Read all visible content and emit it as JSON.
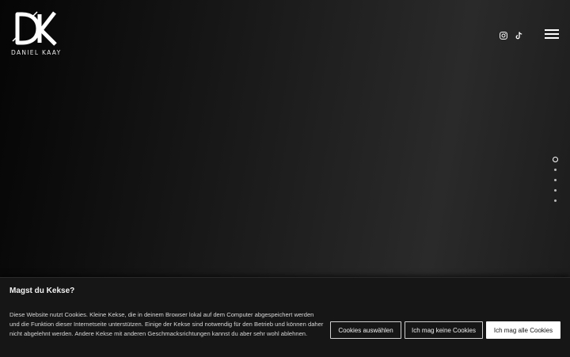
{
  "header": {
    "logo_mark": "DK",
    "logo_text": "DANIEL KAAY",
    "social_icons": [
      "instagram-icon",
      "tiktok-icon"
    ],
    "menu_icon": "hamburger-menu-icon"
  },
  "section_nav": {
    "count": 5,
    "active_index": 0
  },
  "cookie_banner": {
    "title": "Magst du Kekse?",
    "text": "Diese Website nutzt Cookies. Kleine Kekse, die in deinem Browser lokal auf dem Computer abgespeichert werden und die Funktion dieser Internetseite unterstützen. Einige der Kekse sind notwendig für den Betrieb und können daher nicht abgelehnt werden. Andere Kekse mit anderen Geschmacksrichtungen kannst du aber sehr wohl ablehnen.",
    "buttons": {
      "select": "Cookies auswählen",
      "reject": "Ich mag keine Cookies",
      "accept_all": "Ich mag alle Cookies"
    }
  },
  "colors": {
    "background_dark": "#050505",
    "background_light": "#2a2a2a",
    "banner": "#161616",
    "accent": "#ffffff"
  }
}
